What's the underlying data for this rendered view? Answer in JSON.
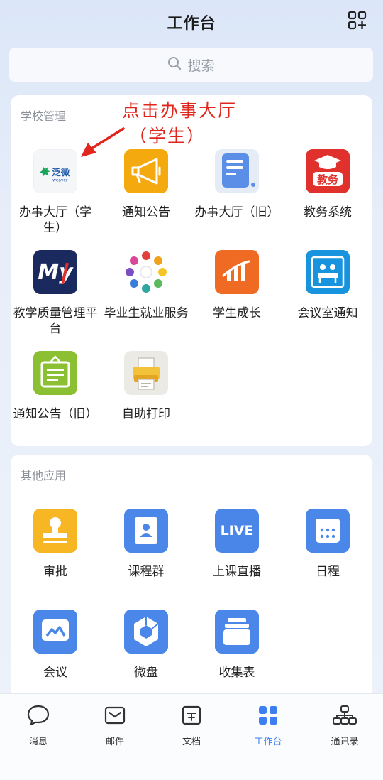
{
  "header": {
    "title": "工作台",
    "apps_icon": "grid-plus-icon"
  },
  "search": {
    "placeholder": "搜索",
    "icon": "search-icon"
  },
  "annotation": {
    "line1": "点击办事大厅",
    "line2": "（学生）",
    "color": "#e0261d"
  },
  "school": {
    "title": "学校管理",
    "apps": [
      {
        "label": "办事大厅（学生）",
        "icon": "fanwei-weaver-logo"
      },
      {
        "label": "通知公告",
        "icon": "megaphone-icon"
      },
      {
        "label": "办事大厅（旧）",
        "icon": "document-list-icon"
      },
      {
        "label": "教务系统",
        "icon": "graduation-cap-icon",
        "badge": "教务"
      },
      {
        "label": "教学质量管理平台",
        "icon": "my-logo-icon",
        "badge": "My"
      },
      {
        "label": "毕业生就业服务",
        "icon": "people-circle-icon"
      },
      {
        "label": "学生成长",
        "icon": "growth-chart-icon"
      },
      {
        "label": "会议室通知",
        "icon": "meeting-room-icon"
      },
      {
        "label": "通知公告（旧）",
        "icon": "notice-board-icon"
      },
      {
        "label": "自助打印",
        "icon": "printer-icon"
      }
    ]
  },
  "other": {
    "title": "其他应用",
    "apps": [
      {
        "label": "审批",
        "icon": "stamp-icon"
      },
      {
        "label": "课程群",
        "icon": "contacts-book-icon"
      },
      {
        "label": "上课直播",
        "icon": "live-icon",
        "badge": "LIVE"
      },
      {
        "label": "日程",
        "icon": "calendar-icon"
      },
      {
        "label": "会议",
        "icon": "meeting-icon"
      },
      {
        "label": "微盘",
        "icon": "cube-drive-icon"
      },
      {
        "label": "收集表",
        "icon": "collection-form-icon"
      }
    ]
  },
  "tabs": [
    {
      "label": "消息",
      "icon": "chat-bubble-icon"
    },
    {
      "label": "邮件",
      "icon": "mail-icon"
    },
    {
      "label": "文档",
      "icon": "document-icon"
    },
    {
      "label": "工作台",
      "icon": "workbench-grid-icon",
      "active": true
    },
    {
      "label": "通讯录",
      "icon": "org-chart-icon"
    }
  ],
  "colors": {
    "accent": "#3d7ff0",
    "annotation": "#e0261d"
  }
}
